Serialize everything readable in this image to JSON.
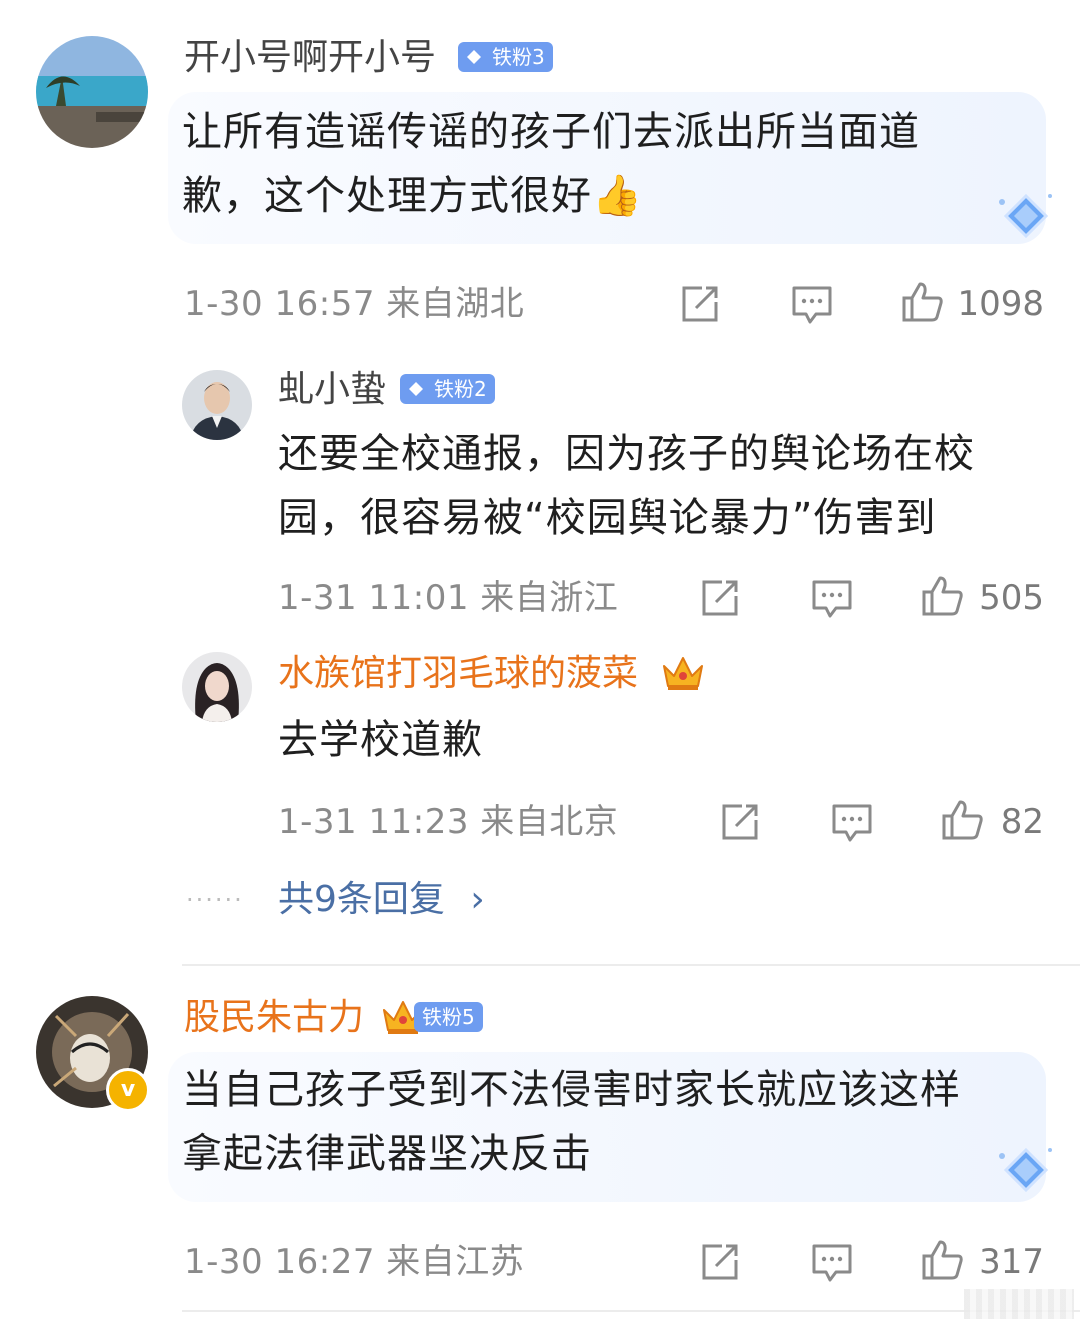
{
  "comments": [
    {
      "username": "开小号啊开小号",
      "badge": "铁粉3",
      "text_line1": "让所有造谣传谣的孩子们去派出所当面道",
      "text_line2": "歉，这个处理方式很好👍",
      "time": "1-30 16:57",
      "location": "来自湖北",
      "likes": "1098"
    },
    {
      "username": "股民朱古力",
      "badge": "铁粉5",
      "text_line1": "当自己孩子受到不法侵害时家长就应该这样",
      "text_line2": "拿起法律武器坚决反击",
      "time": "1-30 16:27",
      "location": "来自江苏",
      "likes": "317"
    }
  ],
  "replies": [
    {
      "username": "虬小蛰",
      "badge": "铁粉2",
      "text_line1": "还要全校通报，因为孩子的舆论场在校",
      "text_line2": "园，很容易被“校园舆论暴力”伤害到",
      "time": "1-31 11:01",
      "location": "来自浙江",
      "likes": "505"
    },
    {
      "username": "水族馆打羽毛球的菠菜",
      "text_line1": "去学校道歉",
      "time": "1-31 11:23",
      "location": "来自北京",
      "likes": "82"
    }
  ],
  "more_replies_label": "共9条回复",
  "more_dots": "······",
  "chevron": "›",
  "verified_mark": "v",
  "icons": {
    "repost": "repost-icon",
    "comment": "comment-icon",
    "like": "like-icon",
    "fan_badge": "diamond-icon",
    "vip": "crown-icon"
  },
  "colors": {
    "badge": "#6e9cf0",
    "vip_name": "#e8731b",
    "link": "#4a6fa5"
  }
}
